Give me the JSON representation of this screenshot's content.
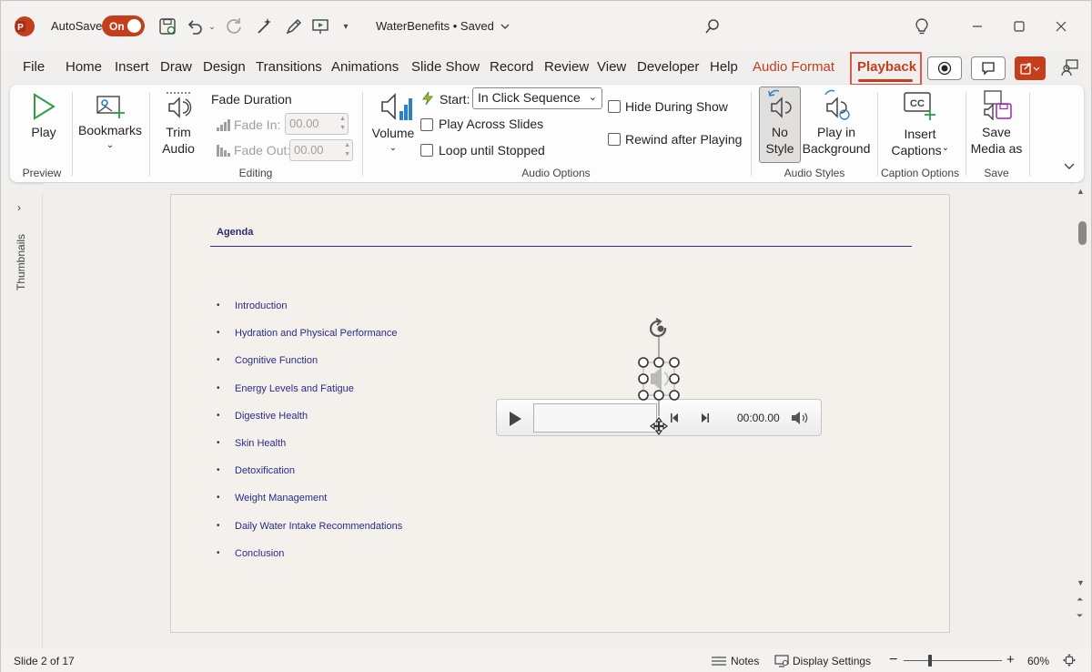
{
  "titlebar": {
    "autosave_label": "AutoSave",
    "autosave_state": "On",
    "document_title": "WaterBenefits • Saved",
    "accent": "#c43e1c"
  },
  "tabs": [
    "File",
    "Home",
    "Insert",
    "Draw",
    "Design",
    "Transitions",
    "Animations",
    "Slide Show",
    "Record",
    "Review",
    "View",
    "Developer",
    "Help",
    "Audio Format",
    "Playback"
  ],
  "ribbon": {
    "preview": {
      "play": "Play",
      "group": "Preview"
    },
    "bookmarks": {
      "label": "Bookmarks"
    },
    "editing": {
      "trim_line1": "Trim",
      "trim_line2": "Audio",
      "fade_duration": "Fade Duration",
      "fade_in_label": "Fade In:",
      "fade_in_value": "00.00",
      "fade_out_label": "Fade Out:",
      "fade_out_value": "00.00",
      "group": "Editing"
    },
    "audio_options": {
      "volume": "Volume",
      "start_label": "Start:",
      "start_value": "In Click Sequence",
      "play_across": "Play Across Slides",
      "loop": "Loop until Stopped",
      "hide": "Hide During Show",
      "rewind": "Rewind after Playing",
      "group": "Audio Options"
    },
    "audio_styles": {
      "no_style_1": "No",
      "no_style_2": "Style",
      "bg_1": "Play in",
      "bg_2": "Background",
      "group": "Audio Styles"
    },
    "captions": {
      "line1": "Insert",
      "line2": "Captions",
      "group": "Caption Options"
    },
    "save": {
      "line1": "Save",
      "line2": "Media as",
      "group": "Save"
    }
  },
  "sidebar": {
    "thumbnails": "Thumbnails"
  },
  "slide": {
    "title": "Agenda",
    "bullets": [
      "Introduction",
      "Hydration and Physical Performance",
      "Cognitive Function",
      "Energy Levels and Fatigue",
      "Digestive Health",
      "Skin Health",
      "Detoxification",
      "Weight Management",
      "Daily Water Intake Recommendations",
      "Conclusion"
    ],
    "player_time": "00:00.00"
  },
  "status": {
    "slide_info": "Slide 2 of 17",
    "notes": "Notes",
    "display_settings": "Display Settings",
    "zoom": "60%"
  }
}
